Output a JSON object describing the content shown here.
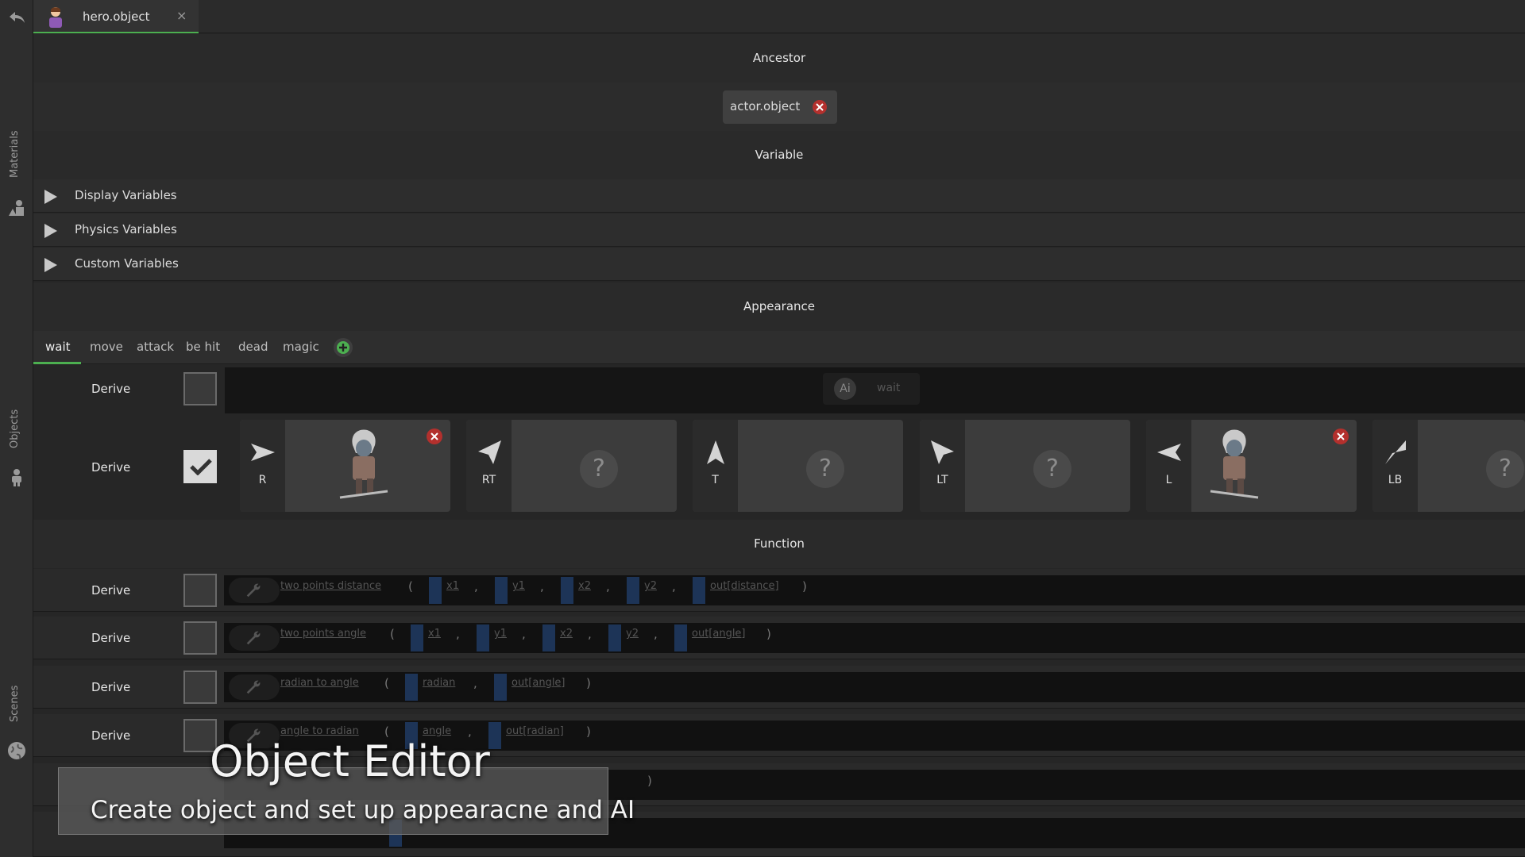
{
  "sidebar": {
    "sections": [
      {
        "label": "Materials",
        "icon": "materials-icon"
      },
      {
        "label": "Objects",
        "icon": "person-icon"
      },
      {
        "label": "Scenes",
        "icon": "globe-icon"
      }
    ]
  },
  "tab": {
    "title": "hero.object",
    "close": "×",
    "icon": "hero-avatar-icon"
  },
  "ancestor": {
    "header": "Ancestor",
    "chip_label": "actor.object"
  },
  "variable": {
    "header": "Variable",
    "groups": [
      "Display Variables",
      "Physics Variables",
      "Custom Variables"
    ]
  },
  "appearance": {
    "header": "Appearance",
    "tabs": [
      "wait",
      "move",
      "attack",
      "be hit",
      "dead",
      "magic"
    ],
    "active_tab": "wait",
    "derive_label": "Derive",
    "ai_badge": "Ai",
    "ai_state": "wait",
    "directions": [
      {
        "label": "R",
        "has_sprite": true
      },
      {
        "label": "RT",
        "has_sprite": false
      },
      {
        "label": "T",
        "has_sprite": false
      },
      {
        "label": "LT",
        "has_sprite": false
      },
      {
        "label": "L",
        "has_sprite": true
      },
      {
        "label": "LB",
        "has_sprite": false
      }
    ],
    "empty_mark": "?"
  },
  "function": {
    "header": "Function",
    "derive_label": "Derive",
    "rows": [
      {
        "name": "two points distance",
        "params": [
          "x1",
          "y1",
          "x2",
          "y2"
        ],
        "out": "out[distance]"
      },
      {
        "name": "two points angle",
        "params": [
          "x1",
          "y1",
          "x2",
          "y2"
        ],
        "out": "out[angle]"
      },
      {
        "name": "radian to angle",
        "params": [
          "radian"
        ],
        "out": "out[angle]"
      },
      {
        "name": "angle to radian",
        "params": [
          "angle"
        ],
        "out": "out[radian]"
      }
    ],
    "open_paren": "(",
    "close_paren": ")",
    "comma": ","
  },
  "overlay": {
    "title": "Object Editor",
    "subtitle": "Create object and set up appearacne and AI"
  },
  "colors": {
    "accent": "#4caf50",
    "remove": "#b3302d",
    "flt": "#1d3457"
  }
}
